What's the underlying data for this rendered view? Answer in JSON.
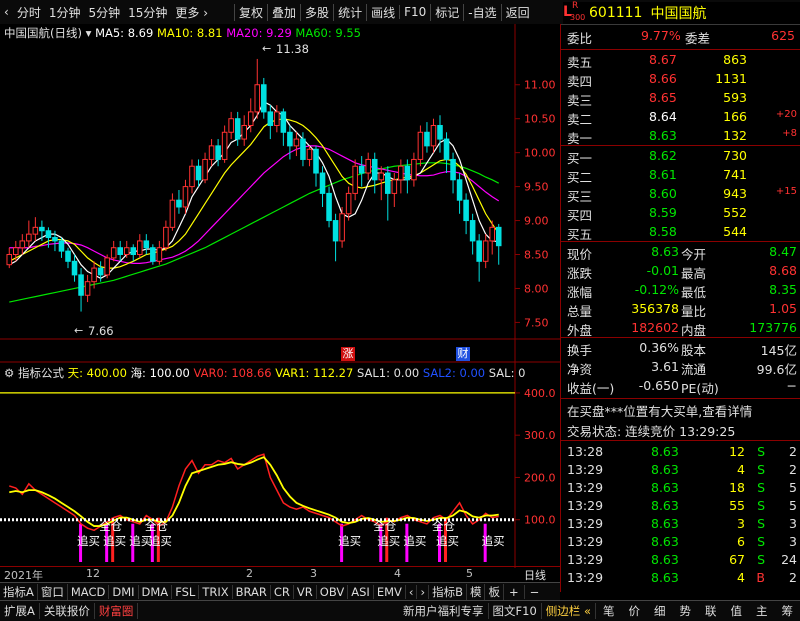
{
  "toolbar": {
    "items": [
      "分时",
      "1分钟",
      "5分钟",
      "15分钟",
      "更多 ›",
      "复权",
      "叠加",
      "多股",
      "统计",
      "画线",
      "F10",
      "标记",
      "-自选",
      "返回"
    ]
  },
  "stock": {
    "market_badge_top": "R",
    "market_badge_bottom": "300",
    "code": "601111",
    "name": "中国国航"
  },
  "main_info": {
    "title": "中国国航(日线)",
    "ma5": "MA5: 8.69",
    "ma10": "MA10: 8.81",
    "ma20": "MA20: 9.29",
    "ma60": "MA60: 9.55"
  },
  "price_axis": [
    "11.00",
    "10.50",
    "10.00",
    "9.50",
    "9.00",
    "8.50",
    "8.00",
    "7.50"
  ],
  "price_marks": {
    "high": "11.38",
    "low": "7.66"
  },
  "event_marks": {
    "zhang": "涨",
    "cai": "财"
  },
  "indicator_info": {
    "name": "指标公式",
    "tian": "天: 400.00",
    "hai": "海: 100.00",
    "var0": "VAR0: 108.66",
    "var1": "VAR1: 112.27",
    "sal1": "SAL1: 0.00",
    "sal2": "SAL2: 0.00",
    "sal": "SAL: 0"
  },
  "ind_axis": [
    "400.0",
    "300.0",
    "200.0",
    "100.0"
  ],
  "signals": {
    "zhuimai": "追买",
    "quancang": "全仓"
  },
  "time_axis": {
    "labels": [
      "2021年",
      "12",
      "2",
      "3",
      "4",
      "5"
    ],
    "cycle": "日线"
  },
  "tabs": [
    "指标A",
    "窗口",
    "MACD",
    "DMI",
    "DMA",
    "FSL",
    "TRIX",
    "BRAR",
    "CR",
    "VR",
    "OBV",
    "ASI",
    "EMV",
    "‹",
    "›",
    "指标B",
    "模",
    "板",
    "+",
    "−"
  ],
  "bottom_tabs": [
    "扩展A",
    "关联报价",
    "财富圈"
  ],
  "bottom_right": [
    "新用户福利专享",
    "图文F10",
    "侧边栏 «",
    "笔",
    "价",
    "细",
    "势",
    "联",
    "值",
    "主",
    "筹"
  ],
  "weibi": {
    "label1": "委比",
    "value1": "9.77%",
    "label2": "委差",
    "value2": "625"
  },
  "asks": [
    {
      "label": "卖五",
      "price": "8.67",
      "vol": "863",
      "chg": ""
    },
    {
      "label": "卖四",
      "price": "8.66",
      "vol": "1131",
      "chg": ""
    },
    {
      "label": "卖三",
      "price": "8.65",
      "vol": "593",
      "chg": ""
    },
    {
      "label": "卖二",
      "price": "8.64",
      "vol": "166",
      "chg": "+20"
    },
    {
      "label": "卖一",
      "price": "8.63",
      "vol": "132",
      "chg": "+8"
    }
  ],
  "bids": [
    {
      "label": "买一",
      "price": "8.62",
      "vol": "730",
      "chg": ""
    },
    {
      "label": "买二",
      "price": "8.61",
      "vol": "741",
      "chg": ""
    },
    {
      "label": "买三",
      "price": "8.60",
      "vol": "943",
      "chg": "+15"
    },
    {
      "label": "买四",
      "price": "8.59",
      "vol": "552",
      "chg": ""
    },
    {
      "label": "买五",
      "price": "8.58",
      "vol": "544",
      "chg": ""
    }
  ],
  "quote": [
    {
      "l1": "现价",
      "v1": "8.63",
      "l2": "今开",
      "v2": "8.47"
    },
    {
      "l1": "涨跌",
      "v1": "-0.01",
      "l2": "最高",
      "v2": "8.68"
    },
    {
      "l1": "涨幅",
      "v1": "-0.12%",
      "l2": "最低",
      "v2": "8.35"
    },
    {
      "l1": "总量",
      "v1": "356378",
      "l2": "量比",
      "v2": "1.05"
    },
    {
      "l1": "外盘",
      "v1": "182602",
      "l2": "内盘",
      "v2": "173776"
    }
  ],
  "fund": [
    {
      "l1": "换手",
      "v1": "0.36%",
      "l2": "股本",
      "v2": "145亿"
    },
    {
      "l1": "净资",
      "v1": "3.61",
      "l2": "流通",
      "v2": "99.6亿"
    },
    {
      "l1": "收益(一)",
      "v1": "-0.650",
      "l2": "PE(动)",
      "v2": "−"
    }
  ],
  "notice": "在买盘***位置有大买单,查看详情",
  "status": "交易状态: 连续竞价 13:29:25",
  "ticks": [
    {
      "time": "13:28",
      "price": "8.63",
      "vol": "12",
      "side": "S",
      "n": "2"
    },
    {
      "time": "13:29",
      "price": "8.63",
      "vol": "4",
      "side": "S",
      "n": "2"
    },
    {
      "time": "13:29",
      "price": "8.63",
      "vol": "18",
      "side": "S",
      "n": "5"
    },
    {
      "time": "13:29",
      "price": "8.63",
      "vol": "55",
      "side": "S",
      "n": "5"
    },
    {
      "time": "13:29",
      "price": "8.63",
      "vol": "3",
      "side": "S",
      "n": "3"
    },
    {
      "time": "13:29",
      "price": "8.63",
      "vol": "6",
      "side": "S",
      "n": "3"
    },
    {
      "time": "13:29",
      "price": "8.63",
      "vol": "67",
      "side": "S",
      "n": "24"
    },
    {
      "time": "13:29",
      "price": "8.63",
      "vol": "4",
      "side": "B",
      "n": "2"
    }
  ],
  "colors": {
    "up": "#ff3232",
    "down": "#00e0e0",
    "green": "#00e600",
    "yellow": "#ffff00",
    "magenta": "#ff00ff",
    "white": "#ffffff",
    "frame": "#8b0000"
  },
  "chart_data": {
    "type": "candlestick",
    "ylim": [
      7.3,
      11.6
    ],
    "candles": [
      [
        8.35,
        8.5,
        8.6,
        8.3
      ],
      [
        8.5,
        8.6,
        8.7,
        8.4
      ],
      [
        8.6,
        8.7,
        8.8,
        8.5
      ],
      [
        8.7,
        8.8,
        9.0,
        8.6
      ],
      [
        8.8,
        8.9,
        9.05,
        8.7
      ],
      [
        8.9,
        8.85,
        9.0,
        8.7
      ],
      [
        8.85,
        8.75,
        8.9,
        8.6
      ],
      [
        8.75,
        8.7,
        8.85,
        8.55
      ],
      [
        8.7,
        8.55,
        8.75,
        8.45
      ],
      [
        8.55,
        8.4,
        8.6,
        8.3
      ],
      [
        8.4,
        8.2,
        8.5,
        8.1
      ],
      [
        8.2,
        7.9,
        8.3,
        7.66
      ],
      [
        7.9,
        8.1,
        8.2,
        7.8
      ],
      [
        8.1,
        8.3,
        8.4,
        8.0
      ],
      [
        8.3,
        8.2,
        8.4,
        8.1
      ],
      [
        8.2,
        8.45,
        8.5,
        8.15
      ],
      [
        8.45,
        8.6,
        8.7,
        8.4
      ],
      [
        8.6,
        8.5,
        8.7,
        8.4
      ],
      [
        8.5,
        8.6,
        8.7,
        8.45
      ],
      [
        8.6,
        8.5,
        8.65,
        8.4
      ],
      [
        8.5,
        8.7,
        8.8,
        8.45
      ],
      [
        8.7,
        8.6,
        8.8,
        8.5
      ],
      [
        8.6,
        8.4,
        8.65,
        8.35
      ],
      [
        8.4,
        8.6,
        8.7,
        8.35
      ],
      [
        8.6,
        8.9,
        9.0,
        8.55
      ],
      [
        8.9,
        9.3,
        9.4,
        8.85
      ],
      [
        9.3,
        9.2,
        9.45,
        9.1
      ],
      [
        9.2,
        9.5,
        9.6,
        9.1
      ],
      [
        9.5,
        9.8,
        9.9,
        9.4
      ],
      [
        9.8,
        9.6,
        9.9,
        9.5
      ],
      [
        9.6,
        9.9,
        10.0,
        9.55
      ],
      [
        9.9,
        10.1,
        10.2,
        9.8
      ],
      [
        10.1,
        9.9,
        10.2,
        9.8
      ],
      [
        9.9,
        10.3,
        10.4,
        9.85
      ],
      [
        10.3,
        10.5,
        10.6,
        10.2
      ],
      [
        10.5,
        10.2,
        10.6,
        10.1
      ],
      [
        10.2,
        10.4,
        10.55,
        10.1
      ],
      [
        10.4,
        10.6,
        10.8,
        10.3
      ],
      [
        10.6,
        11.0,
        11.38,
        10.5
      ],
      [
        11.0,
        10.6,
        11.1,
        10.5
      ],
      [
        10.6,
        10.4,
        10.7,
        10.2
      ],
      [
        10.4,
        10.6,
        10.7,
        10.3
      ],
      [
        10.6,
        10.3,
        10.65,
        10.1
      ],
      [
        10.3,
        10.1,
        10.4,
        9.9
      ],
      [
        10.1,
        10.2,
        10.3,
        9.95
      ],
      [
        10.2,
        9.9,
        10.3,
        9.8
      ],
      [
        9.9,
        10.05,
        10.1,
        9.8
      ],
      [
        10.05,
        9.7,
        10.1,
        9.5
      ],
      [
        9.7,
        9.4,
        9.8,
        9.2
      ],
      [
        9.4,
        9.0,
        9.5,
        8.9
      ],
      [
        9.0,
        8.7,
        9.1,
        8.4
      ],
      [
        8.7,
        9.1,
        9.2,
        8.6
      ],
      [
        9.1,
        9.4,
        9.5,
        9.0
      ],
      [
        9.4,
        9.8,
        9.9,
        9.3
      ],
      [
        9.8,
        9.7,
        9.95,
        9.5
      ],
      [
        9.7,
        9.9,
        10.0,
        9.6
      ],
      [
        9.9,
        9.6,
        10.0,
        9.4
      ],
      [
        9.6,
        9.7,
        9.8,
        9.3
      ],
      [
        9.7,
        9.4,
        9.8,
        9.0
      ],
      [
        9.4,
        9.6,
        9.7,
        9.2
      ],
      [
        9.6,
        9.8,
        9.9,
        9.4
      ],
      [
        9.8,
        9.6,
        9.9,
        9.4
      ],
      [
        9.6,
        9.9,
        10.0,
        9.5
      ],
      [
        9.9,
        10.3,
        10.4,
        9.8
      ],
      [
        10.3,
        10.1,
        10.45,
        10.0
      ],
      [
        10.1,
        10.4,
        10.5,
        10.0
      ],
      [
        10.4,
        10.2,
        10.55,
        10.0
      ],
      [
        10.2,
        9.9,
        10.3,
        9.7
      ],
      [
        9.9,
        9.6,
        10.0,
        9.4
      ],
      [
        9.6,
        9.3,
        9.7,
        9.1
      ],
      [
        9.3,
        9.0,
        9.4,
        8.8
      ],
      [
        9.0,
        8.7,
        9.1,
        8.5
      ],
      [
        8.7,
        8.4,
        8.8,
        8.1
      ],
      [
        8.4,
        8.7,
        8.8,
        8.3
      ],
      [
        8.7,
        8.9,
        9.0,
        8.5
      ],
      [
        8.9,
        8.63,
        8.95,
        8.35
      ]
    ],
    "ma5": [
      8.35,
      8.4,
      8.5,
      8.6,
      8.7,
      8.75,
      8.8,
      8.8,
      8.75,
      8.65,
      8.5,
      8.35,
      8.25,
      8.2,
      8.15,
      8.2,
      8.3,
      8.4,
      8.5,
      8.55,
      8.55,
      8.58,
      8.58,
      8.56,
      8.6,
      8.7,
      8.9,
      9.1,
      9.35,
      9.5,
      9.65,
      9.8,
      9.9,
      10.0,
      10.15,
      10.2,
      10.3,
      10.4,
      10.55,
      10.75,
      10.7,
      10.6,
      10.55,
      10.4,
      10.3,
      10.2,
      10.1,
      10.0,
      9.85,
      9.65,
      9.35,
      9.1,
      9.05,
      9.1,
      9.3,
      9.55,
      9.7,
      9.7,
      9.65,
      9.6,
      9.6,
      9.6,
      9.65,
      9.7,
      9.85,
      10.0,
      10.15,
      10.2,
      10.1,
      9.9,
      9.6,
      9.3,
      9.0,
      8.8,
      8.7,
      8.69
    ],
    "ma10": [
      8.4,
      8.45,
      8.5,
      8.55,
      8.6,
      8.65,
      8.7,
      8.72,
      8.72,
      8.7,
      8.65,
      8.55,
      8.45,
      8.38,
      8.32,
      8.3,
      8.3,
      8.32,
      8.36,
      8.4,
      8.45,
      8.5,
      8.52,
      8.55,
      8.58,
      8.62,
      8.7,
      8.8,
      8.95,
      9.1,
      9.25,
      9.4,
      9.55,
      9.7,
      9.82,
      9.92,
      10.02,
      10.12,
      10.25,
      10.38,
      10.45,
      10.48,
      10.5,
      10.48,
      10.45,
      10.4,
      10.32,
      10.22,
      10.1,
      9.95,
      9.8,
      9.65,
      9.55,
      9.5,
      9.48,
      9.5,
      9.52,
      9.55,
      9.58,
      9.6,
      9.62,
      9.64,
      9.66,
      9.7,
      9.76,
      9.82,
      9.88,
      9.9,
      9.88,
      9.8,
      9.68,
      9.5,
      9.3,
      9.1,
      8.95,
      8.81
    ],
    "ma20": [
      8.6,
      8.6,
      8.6,
      8.6,
      8.62,
      8.63,
      8.65,
      8.66,
      8.67,
      8.67,
      8.66,
      8.64,
      8.6,
      8.55,
      8.5,
      8.45,
      8.42,
      8.4,
      8.38,
      8.37,
      8.37,
      8.38,
      8.4,
      8.42,
      8.44,
      8.46,
      8.5,
      8.55,
      8.62,
      8.7,
      8.8,
      8.9,
      9.0,
      9.1,
      9.2,
      9.3,
      9.4,
      9.5,
      9.6,
      9.7,
      9.78,
      9.86,
      9.94,
      10.0,
      10.05,
      10.08,
      10.1,
      10.1,
      10.08,
      10.05,
      10.0,
      9.95,
      9.9,
      9.85,
      9.82,
      9.8,
      9.78,
      9.76,
      9.74,
      9.72,
      9.7,
      9.68,
      9.67,
      9.66,
      9.66,
      9.67,
      9.7,
      9.72,
      9.72,
      9.7,
      9.65,
      9.58,
      9.5,
      9.42,
      9.35,
      9.29
    ],
    "ma60": [
      7.8,
      7.82,
      7.84,
      7.86,
      7.88,
      7.9,
      7.92,
      7.94,
      7.96,
      7.98,
      8.0,
      8.02,
      8.04,
      8.06,
      8.08,
      8.1,
      8.12,
      8.15,
      8.18,
      8.21,
      8.24,
      8.27,
      8.3,
      8.33,
      8.36,
      8.4,
      8.44,
      8.48,
      8.52,
      8.56,
      8.6,
      8.65,
      8.7,
      8.75,
      8.8,
      8.85,
      8.9,
      8.95,
      9.0,
      9.05,
      9.1,
      9.15,
      9.2,
      9.25,
      9.3,
      9.35,
      9.4,
      9.44,
      9.48,
      9.52,
      9.56,
      9.6,
      9.63,
      9.66,
      9.69,
      9.72,
      9.74,
      9.76,
      9.78,
      9.8,
      9.81,
      9.82,
      9.83,
      9.84,
      9.85,
      9.85,
      9.85,
      9.84,
      9.82,
      9.8,
      9.77,
      9.73,
      9.69,
      9.64,
      9.6,
      9.55
    ],
    "indicator": {
      "ylim": [
        0,
        440
      ],
      "red_line": [
        180,
        175,
        160,
        185,
        170,
        160,
        150,
        140,
        130,
        120,
        110,
        90,
        80,
        75,
        85,
        95,
        105,
        110,
        100,
        95,
        90,
        110,
        100,
        85,
        95,
        130,
        180,
        220,
        240,
        210,
        230,
        230,
        240,
        235,
        245,
        220,
        230,
        240,
        250,
        255,
        200,
        170,
        140,
        130,
        125,
        130,
        120,
        115,
        110,
        105,
        95,
        85,
        90,
        100,
        110,
        100,
        95,
        85,
        100,
        95,
        105,
        110,
        100,
        95,
        90,
        105,
        110,
        100,
        120,
        140,
        110,
        90,
        100,
        115,
        105,
        108
      ],
      "yellow_line": [
        165,
        168,
        165,
        170,
        170,
        165,
        158,
        150,
        140,
        130,
        120,
        108,
        95,
        85,
        85,
        90,
        98,
        105,
        105,
        100,
        95,
        100,
        100,
        95,
        95,
        110,
        140,
        180,
        210,
        215,
        220,
        225,
        230,
        232,
        236,
        232,
        230,
        235,
        242,
        248,
        230,
        205,
        175,
        155,
        140,
        133,
        127,
        122,
        117,
        112,
        105,
        95,
        92,
        95,
        102,
        104,
        100,
        95,
        97,
        97,
        100,
        105,
        104,
        100,
        97,
        100,
        104,
        104,
        110,
        122,
        118,
        108,
        105,
        110,
        110,
        112
      ],
      "baseline": 100,
      "top_line": 400,
      "signal_bars": [
        11,
        15,
        19,
        22,
        51,
        57,
        61,
        66,
        73
      ]
    }
  }
}
